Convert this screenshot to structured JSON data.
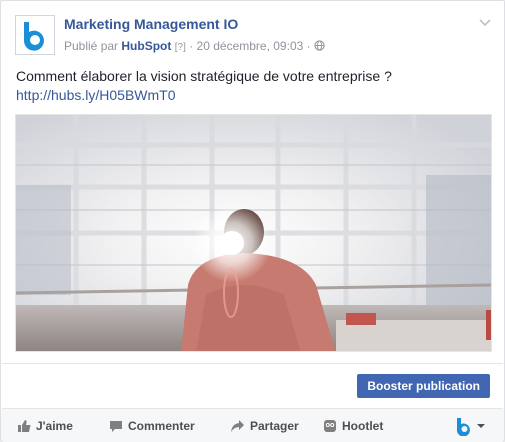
{
  "post": {
    "page_name": "Marketing Management IO",
    "published_by_prefix": "Publié par",
    "publisher": "HubSpot",
    "help_marker": "[?]",
    "separator": "·",
    "timestamp": "20 décembre, 09:03",
    "separator2": "·",
    "privacy_icon": "globe-icon",
    "message": "Comment élaborer la vision stratégique de votre entreprise ?",
    "link": "http://hubs.ly/H05BWmT0"
  },
  "boost": {
    "label": "Booster publication"
  },
  "actions": [
    {
      "label": "J'aime",
      "icon": "thumbs-up-icon"
    },
    {
      "label": "Commenter",
      "icon": "comment-icon"
    },
    {
      "label": "Partager",
      "icon": "share-icon"
    },
    {
      "label": "Hootlet",
      "icon": "hootlet-owl-icon"
    }
  ],
  "colors": {
    "brand_blue": "#365899",
    "button_blue": "#4267b2",
    "logo_blue": "#1a8fd8"
  }
}
